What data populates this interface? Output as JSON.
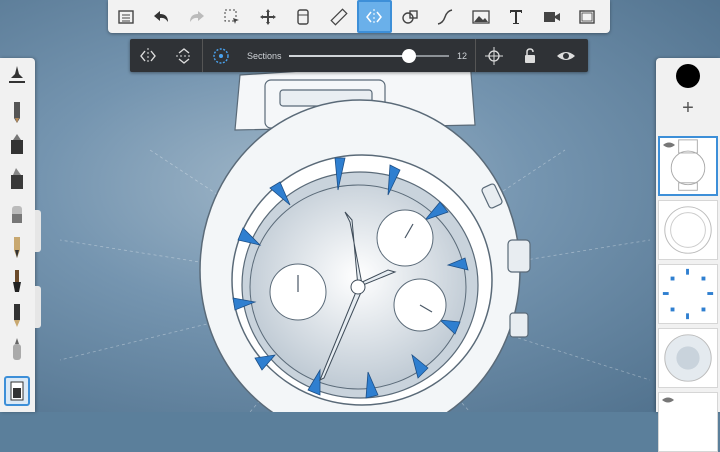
{
  "toolbar": {
    "items": [
      {
        "icon": "layers-list-icon"
      },
      {
        "icon": "undo-icon"
      },
      {
        "icon": "redo-icon"
      },
      {
        "icon": "selection-icon"
      },
      {
        "icon": "transform-icon"
      },
      {
        "icon": "copic-icon"
      },
      {
        "icon": "ruler-icon"
      },
      {
        "icon": "symmetry-icon",
        "active": true
      },
      {
        "icon": "shapes-icon"
      },
      {
        "icon": "curve-icon"
      },
      {
        "icon": "image-icon"
      },
      {
        "icon": "text-icon"
      },
      {
        "icon": "video-icon"
      },
      {
        "icon": "fullscreen-icon"
      }
    ]
  },
  "symmetry_bar": {
    "sections_label": "Sections",
    "sections_value": "12",
    "sections_level_percent": 75
  },
  "colors": {
    "accent": "#3d8fd8",
    "canvas": "#6f8fa9",
    "toolbar": "#f2f2f2",
    "symbar": "#2f3236",
    "watch_blue": "#2f7fd0"
  }
}
